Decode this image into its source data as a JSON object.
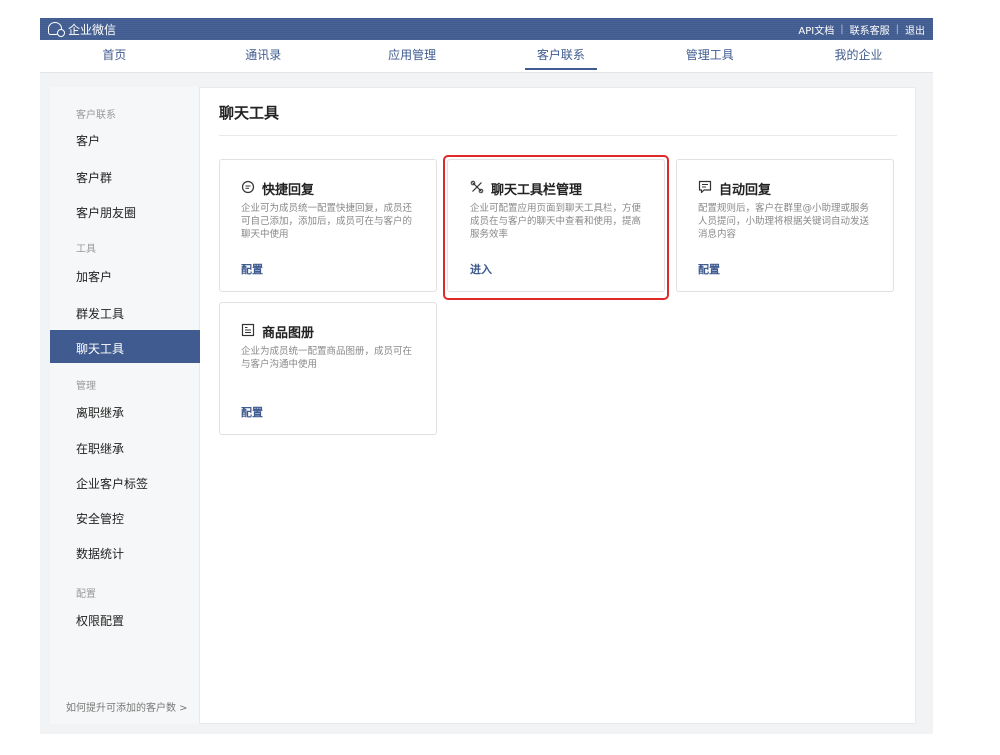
{
  "topbar": {
    "brand": "企业微信",
    "links": [
      "API文档",
      "联系客服",
      "退出"
    ]
  },
  "nav": {
    "items": [
      "首页",
      "通讯录",
      "应用管理",
      "客户联系",
      "管理工具",
      "我的企业"
    ],
    "active": "客户联系"
  },
  "sidebar": {
    "group_customer": "客户联系",
    "item_customer": "客户",
    "item_group": "客户群",
    "item_moments": "客户朋友圈",
    "group_tools": "工具",
    "item_add": "加客户",
    "item_mass": "群发工具",
    "item_chat_tools": "聊天工具",
    "group_manage": "管理",
    "item_resign": "离职继承",
    "item_onjob": "在职继承",
    "item_tags": "企业客户标签",
    "item_security": "安全管控",
    "item_stats": "数据统计",
    "group_config": "配置",
    "item_permission": "权限配置",
    "footer": "如何提升可添加的客户数 >"
  },
  "main": {
    "title": "聊天工具",
    "cards": [
      {
        "title": "快捷回复",
        "desc": [
          "企业可为成员统一配置快捷回复，成员还",
          "可自己添加，添加后，成员可在与客户的",
          "聊天中使用"
        ],
        "link": "配置",
        "icon": "chat-bubble-icon"
      },
      {
        "title": "聊天工具栏管理",
        "desc": [
          "企业可配置应用页面到聊天工具栏，方便",
          "成员在与客户的聊天中查看和使用，提高",
          "服务效率"
        ],
        "link": "进入",
        "icon": "tools-icon"
      },
      {
        "title": "自动回复",
        "desc": [
          "配置规则后，客户在群里@小助理或服务",
          "人员提问，小助理将根据关键词自动发送",
          "消息内容"
        ],
        "link": "配置",
        "icon": "message-reply-icon"
      },
      {
        "title": "商品图册",
        "desc": [
          "企业为成员统一配置商品图册，成员可在",
          "与客户沟通中使用"
        ],
        "link": "配置",
        "icon": "catalog-icon"
      }
    ]
  },
  "colors": {
    "primary": "#3f5b8f",
    "highlight": "#e02a2a"
  }
}
